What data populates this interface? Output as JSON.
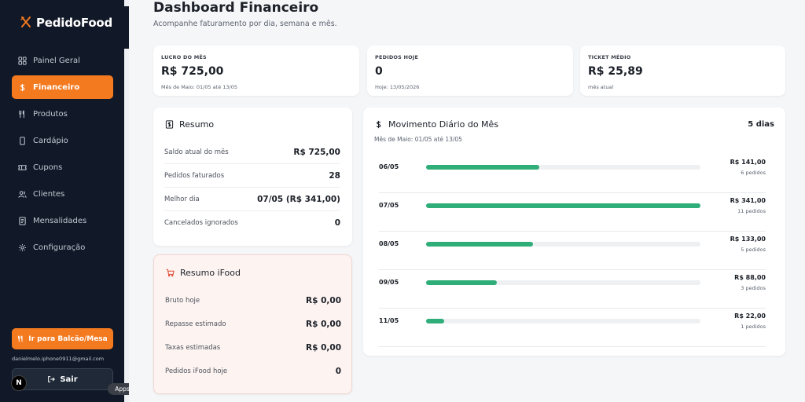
{
  "brand": {
    "name": "PedidoFood"
  },
  "sidebar": {
    "items": [
      {
        "label": "Painel Geral",
        "icon": "grid-icon"
      },
      {
        "label": "Financeiro",
        "icon": "dollar-icon",
        "active": true
      },
      {
        "label": "Produtos",
        "icon": "utensils-icon"
      },
      {
        "label": "Cardápio",
        "icon": "phone-icon"
      },
      {
        "label": "Cupons",
        "icon": "ticket-icon"
      },
      {
        "label": "Clientes",
        "icon": "users-icon"
      },
      {
        "label": "Mensalidades",
        "icon": "receipt-icon"
      },
      {
        "label": "Configuração",
        "icon": "gear-icon"
      }
    ],
    "counter_button": "Ir para Balcão/Mesa",
    "email": "danielmelo.iphone0911@gmail.com",
    "logout_label": "Sair"
  },
  "overlay": {
    "n_badge": "N",
    "apps_label": "Apps"
  },
  "header": {
    "title": "Dashboard Financeiro",
    "subtitle": "Acompanhe faturamento por dia, semana e mês."
  },
  "kpis": [
    {
      "label": "LUCRO DO MÊS",
      "value": "R$ 725,00",
      "sub": "Mês de Maio: 01/05 até 13/05"
    },
    {
      "label": "PEDIDOS HOJE",
      "value": "0",
      "sub": "Hoje: 13/05/2026"
    },
    {
      "label": "TICKET MÉDIO",
      "value": "R$ 25,89",
      "sub": "mês atual"
    }
  ],
  "resumo": {
    "title": "Resumo",
    "rows": [
      {
        "label": "Saldo atual do mês",
        "value": "R$ 725,00"
      },
      {
        "label": "Pedidos faturados",
        "value": "28"
      },
      {
        "label": "Melhor dia",
        "value": "07/05 (R$ 341,00)"
      },
      {
        "label": "Cancelados ignorados",
        "value": "0"
      }
    ]
  },
  "resumo_ifood": {
    "title": "Resumo iFood",
    "rows": [
      {
        "label": "Bruto hoje",
        "value": "R$ 0,00"
      },
      {
        "label": "Repasse estimado",
        "value": "R$ 0,00"
      },
      {
        "label": "Taxas estimadas",
        "value": "R$ 0,00"
      },
      {
        "label": "Pedidos iFood hoje",
        "value": "0"
      }
    ]
  },
  "movimento": {
    "title": "Movimento Diário do Mês",
    "subtitle": "Mês de Maio: 01/05 até 13/05",
    "count_label": "5 dias",
    "days": [
      {
        "date": "06/05",
        "amount": "R$ 141,00",
        "orders": "6 pedidos",
        "value": 141
      },
      {
        "date": "07/05",
        "amount": "R$ 341,00",
        "orders": "11 pedidos",
        "value": 341
      },
      {
        "date": "08/05",
        "amount": "R$ 133,00",
        "orders": "5 pedidos",
        "value": 133
      },
      {
        "date": "09/05",
        "amount": "R$ 88,00",
        "orders": "3 pedidos",
        "value": 88
      },
      {
        "date": "11/05",
        "amount": "R$ 22,00",
        "orders": "1 pedidos",
        "value": 22
      }
    ]
  },
  "colors": {
    "accent": "#f47a20",
    "sidebar_bg": "#111827",
    "bar": "#2fae79"
  }
}
